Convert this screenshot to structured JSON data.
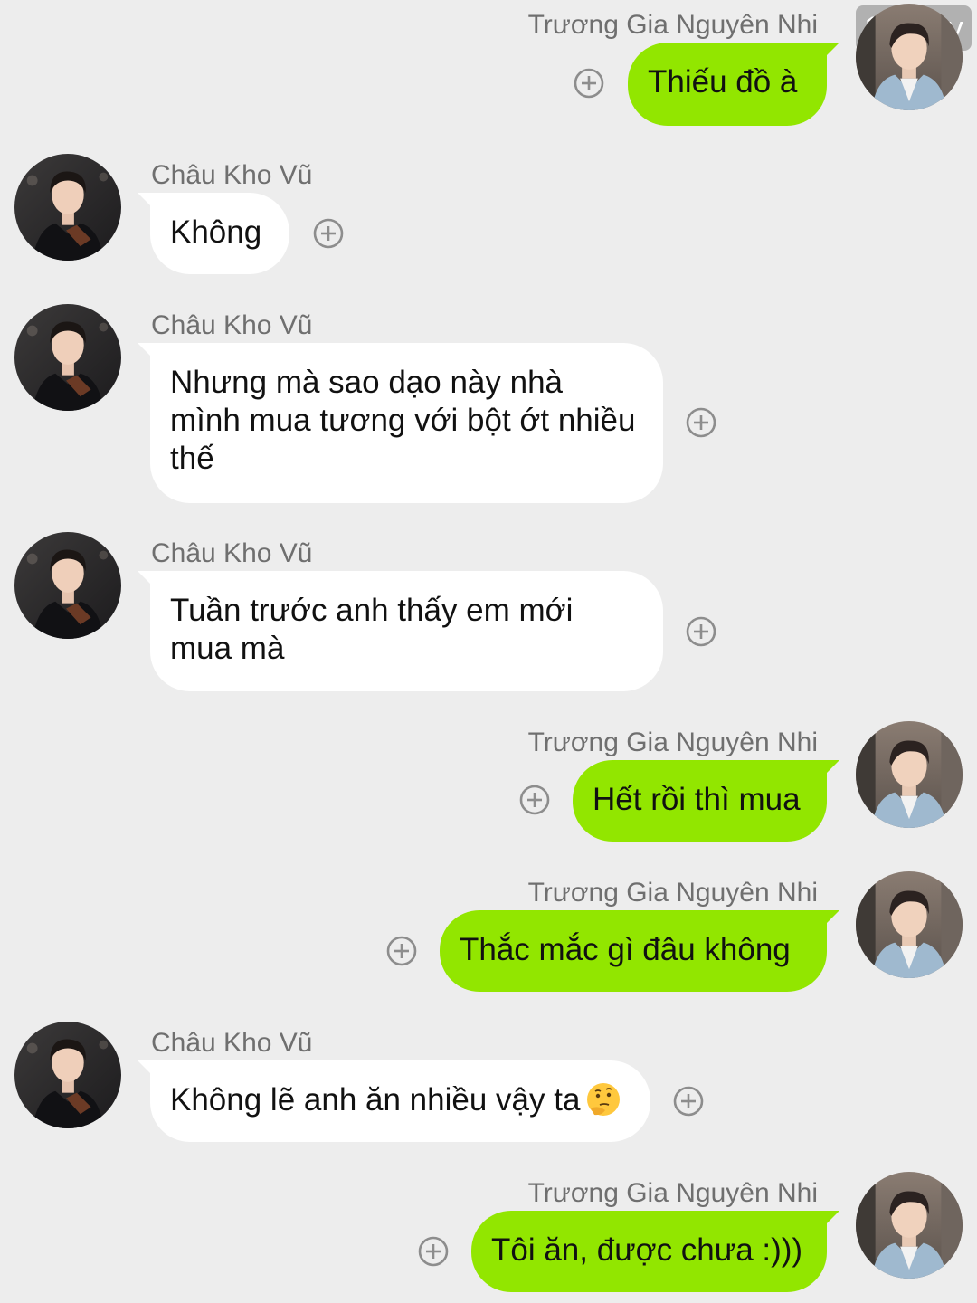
{
  "watermark": "127 joy",
  "contacts": {
    "me": "Trương Gia Nguyên Nhi",
    "other": "Châu Kho Vũ"
  },
  "messages": [
    {
      "sender": "Trương Gia Nguyên Nhi",
      "text": "Thiếu đồ à"
    },
    {
      "sender": "Châu Kho Vũ",
      "text": "Không"
    },
    {
      "sender": "Châu Kho Vũ",
      "text": "Nhưng mà sao dạo này nhà\nmình mua tương với bột ớt nhiều\nthế"
    },
    {
      "sender": "Châu Kho Vũ",
      "text": "Tuần trước anh thấy em mới\nmua mà"
    },
    {
      "sender": "Trương Gia Nguyên Nhi",
      "text": "Hết rồi thì mua"
    },
    {
      "sender": "Trương Gia Nguyên Nhi",
      "text": "Thắc mắc gì đâu không"
    },
    {
      "sender": "Châu Kho Vũ",
      "text": "Không lẽ anh ăn nhiều vậy ta",
      "emoji": "thinking-face"
    },
    {
      "sender": "Trương Gia Nguyên Nhi",
      "text": "Tôi ăn, được chưa :)))"
    }
  ],
  "colors": {
    "background": "#ededed",
    "outgoing_bubble": "#92e600",
    "incoming_bubble": "#ffffff"
  }
}
